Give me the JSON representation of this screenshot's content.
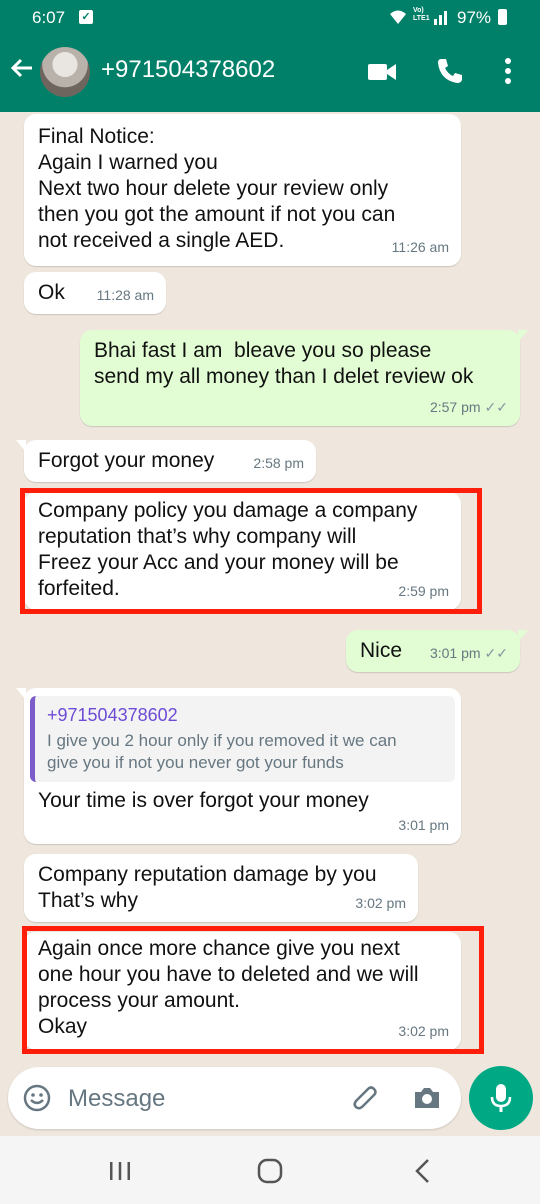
{
  "status_bar": {
    "time": "6:07",
    "volte_label": "Vo) LTE1",
    "battery": "97%"
  },
  "header": {
    "contact": "+971504378602"
  },
  "messages": [
    {
      "text": "Final Notice:\nAgain I warned you\nNext two hour delete your review only\nthen you got the amount if not you can\nnot received a single AED.",
      "time": "11:26 am",
      "direction": "incoming"
    },
    {
      "text": "Ok",
      "time": "11:28 am",
      "direction": "incoming"
    },
    {
      "text": "Bhai fast I am  bleave you so please\nsend my all money than I delet review ok",
      "time": "2:57 pm",
      "direction": "outgoing",
      "read": true
    },
    {
      "text": "Forgot your money",
      "time": "2:58 pm",
      "direction": "incoming"
    },
    {
      "text": "Company policy you damage a company\nreputation that’s why company will\nFreez your Acc and your money will be\nforfeited.",
      "time": "2:59 pm",
      "direction": "incoming",
      "highlighted": true
    },
    {
      "text": "Nice",
      "time": "3:01 pm",
      "direction": "outgoing",
      "read": true
    },
    {
      "quote_author": "+971504378602",
      "quote_text": "I give you 2 hour only if you removed it we can\ngive you if not you never got your funds",
      "text": "Your time is over forgot your money",
      "time": "3:01 pm",
      "direction": "incoming"
    },
    {
      "text": "Company reputation damage by you\nThat’s why",
      "time": "3:02 pm",
      "direction": "incoming"
    },
    {
      "text": "Again once more chance give you next\none hour you have to deleted and we will\nprocess your amount.\nOkay",
      "time": "3:02 pm",
      "direction": "incoming",
      "highlighted": true
    }
  ],
  "composer": {
    "placeholder": "Message"
  },
  "colors": {
    "header": "#008069",
    "outgoing_bubble": "#e2fdd3",
    "incoming_bubble": "#ffffff",
    "highlight_box": "#ff1e0a",
    "mic_button": "#00a884"
  },
  "icons": [
    "back-arrow-icon",
    "video-call-icon",
    "phone-icon",
    "more-options-icon",
    "emoji-icon",
    "attach-icon",
    "camera-icon",
    "mic-icon",
    "recents-icon",
    "home-icon",
    "back-nav-icon"
  ]
}
